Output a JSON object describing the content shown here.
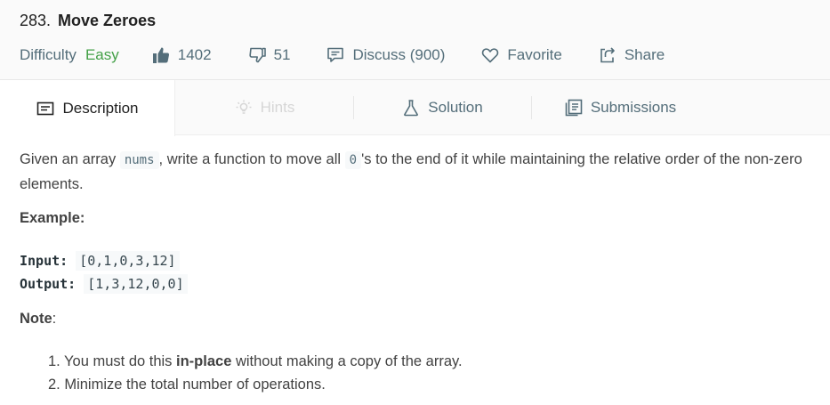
{
  "problem": {
    "number": "283.",
    "name": "Move Zeroes"
  },
  "meta": {
    "difficulty_label": "Difficulty",
    "difficulty_value": "Easy",
    "likes": "1402",
    "dislikes": "51",
    "discuss": "Discuss (900)",
    "favorite": "Favorite",
    "share": "Share",
    "colors": {
      "easy": "#43a047",
      "meta_text": "#546e7a"
    }
  },
  "tabs": [
    {
      "label": "Description",
      "icon": "description-icon",
      "state": "active"
    },
    {
      "label": "Hints",
      "icon": "lightbulb-icon",
      "state": "disabled"
    },
    {
      "label": "Solution",
      "icon": "flask-icon",
      "state": "normal"
    },
    {
      "label": "Submissions",
      "icon": "submissions-icon",
      "state": "normal"
    }
  ],
  "description": {
    "part1": "Given an array ",
    "code1": "nums",
    "part2": ", write a function to move all ",
    "code2": "0",
    "part3": "'s to the end of it while maintaining the relative order of the non-zero elements."
  },
  "example": {
    "title": "Example:",
    "input_label": "Input:",
    "input_value": "[0,1,0,3,12]",
    "output_label": "Output:",
    "output_value": "[1,3,12,0,0]"
  },
  "note": {
    "title": "Note",
    "colon": ":",
    "item1_prefix": "1. You must do this ",
    "item1_bold": "in-place",
    "item1_suffix": " without making a copy of the array.",
    "item2": "2. Minimize the total number of operations."
  }
}
